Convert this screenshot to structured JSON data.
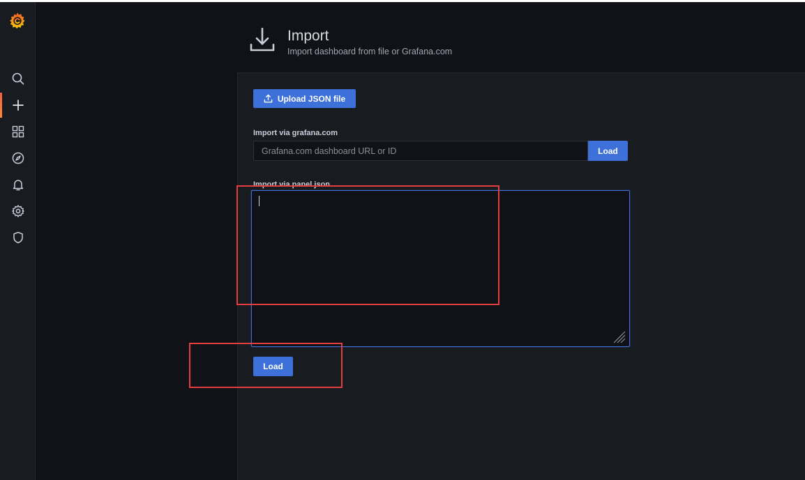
{
  "header": {
    "title": "Import",
    "subtitle": "Import dashboard from file or Grafana.com"
  },
  "sidebar": {
    "items": [
      {
        "icon": "search-icon"
      },
      {
        "icon": "plus-icon",
        "active": true
      },
      {
        "icon": "dashboards-icon"
      },
      {
        "icon": "compass-icon"
      },
      {
        "icon": "bell-icon"
      },
      {
        "icon": "gear-icon"
      },
      {
        "icon": "shield-icon"
      }
    ]
  },
  "upload": {
    "label": "Upload JSON file"
  },
  "grafana_com": {
    "label": "Import via grafana.com",
    "placeholder": "Grafana.com dashboard URL or ID",
    "value": "",
    "load_label": "Load"
  },
  "panel_json": {
    "label": "Import via panel json",
    "value": "",
    "load_label": "Load"
  },
  "colors": {
    "primary": "#3d71d9",
    "brand": "#f55f3e",
    "annotation": "#e53e3e"
  }
}
